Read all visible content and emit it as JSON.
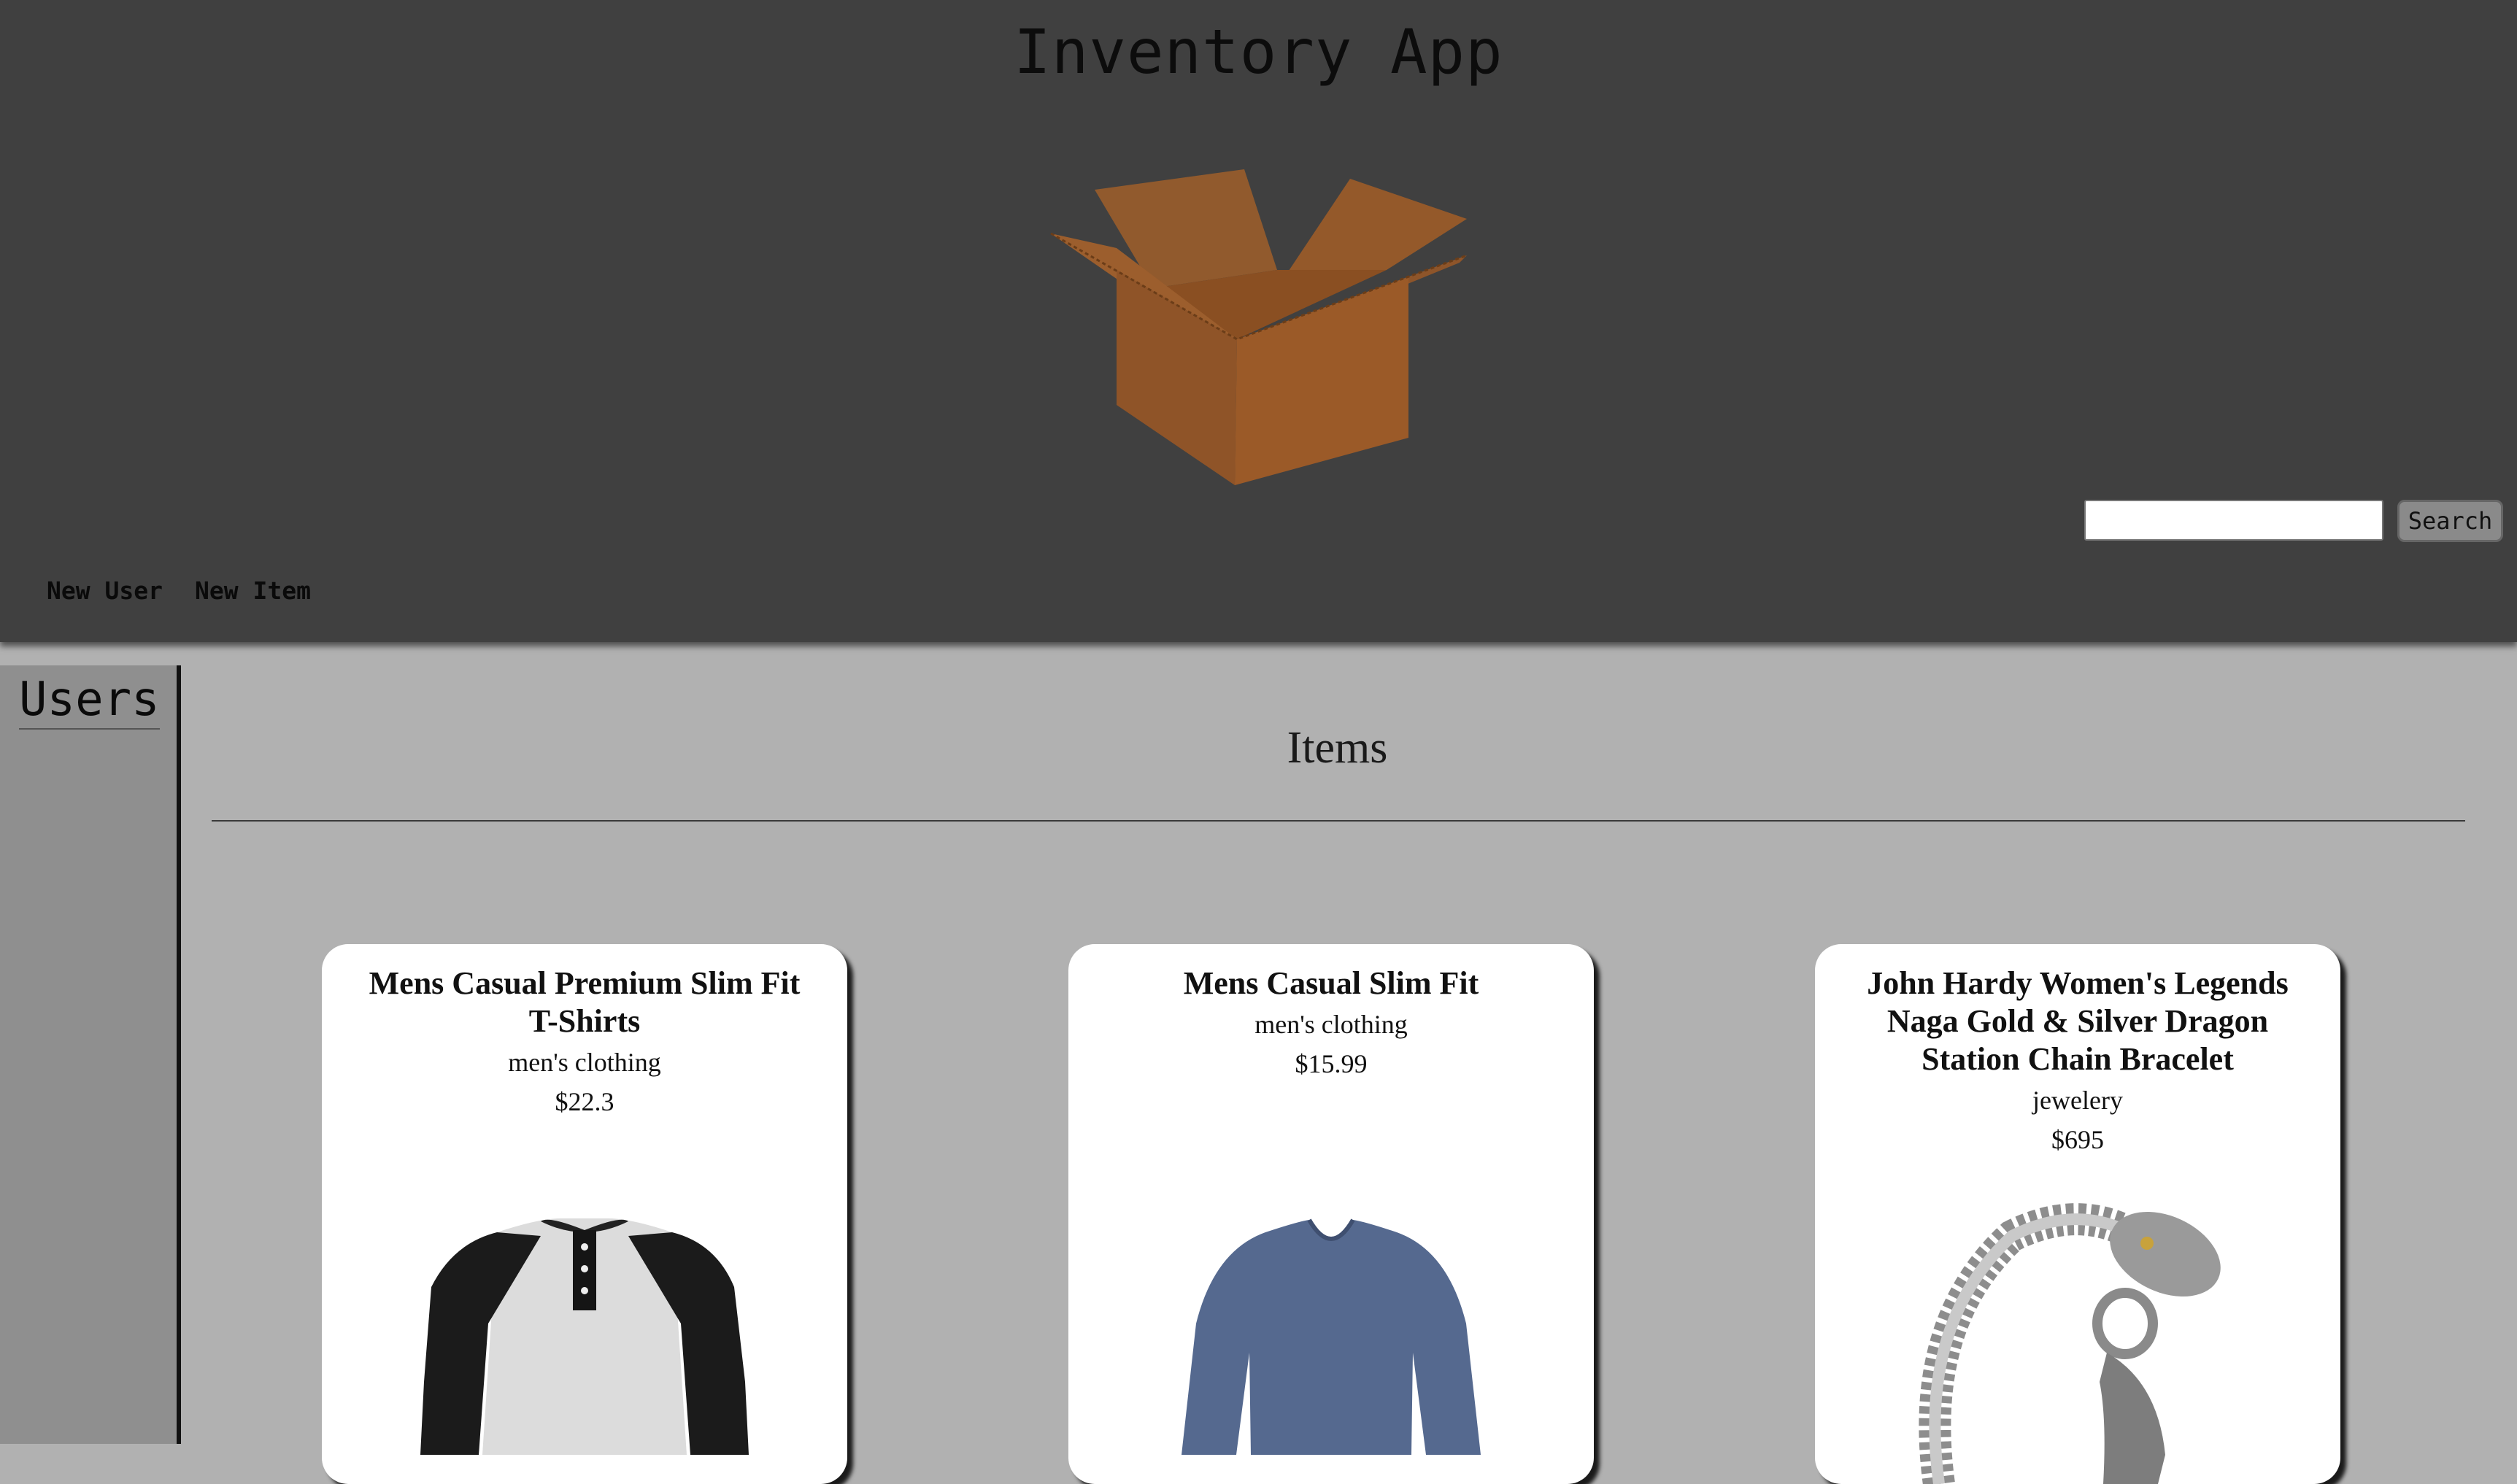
{
  "app": {
    "title": "Inventory App"
  },
  "header": {
    "logo_icon": "cardboard-box-icon",
    "search": {
      "value": "",
      "placeholder": "",
      "button_label": "Search"
    },
    "nav": [
      {
        "label": "New User"
      },
      {
        "label": "New Item"
      }
    ]
  },
  "sidebar": {
    "title": "Users"
  },
  "main": {
    "heading": "Items",
    "items": [
      {
        "title": "Mens Casual Premium Slim Fit T-Shirts",
        "category": "men's clothing",
        "price": "$22.3",
        "image_icon": "raglan-henley-shirt-icon"
      },
      {
        "title": "Mens Casual Slim Fit",
        "category": "men's clothing",
        "price": "$15.99",
        "image_icon": "long-sleeve-shirt-icon"
      },
      {
        "title": "John Hardy Women's Legends Naga Gold & Silver Dragon Station Chain Bracelet",
        "category": "jewelery",
        "price": "$695",
        "image_icon": "dragon-bracelet-icon"
      }
    ]
  },
  "colors": {
    "header_bg": "#404040",
    "page_bg": "#b1b1b1",
    "sidebar_bg": "#8f8f8f",
    "card_bg": "#ffffff",
    "box_brown": "#a0612e"
  }
}
